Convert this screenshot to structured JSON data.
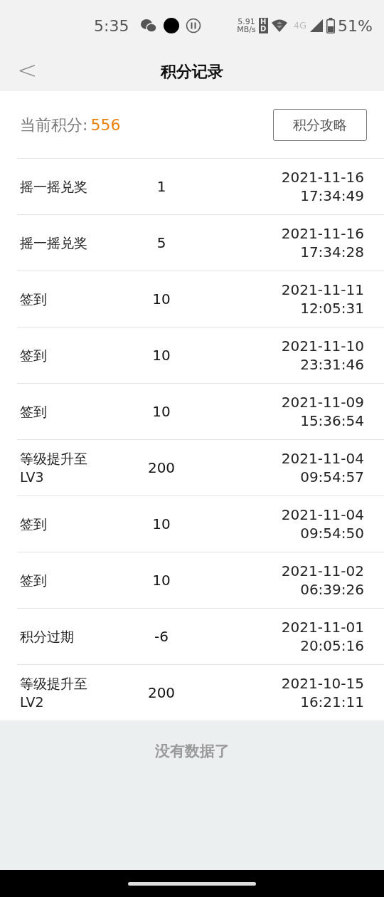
{
  "status_bar": {
    "time": "5:35",
    "net_speed": "5.91",
    "net_unit": "MB/s",
    "hd": "HD",
    "network": "4G",
    "battery": "51%"
  },
  "header": {
    "back": "<",
    "title": "积分记录"
  },
  "summary": {
    "label": "当前积分:",
    "points": "556",
    "guide_button": "积分攻略"
  },
  "records": [
    {
      "name": "摇一摇兑奖",
      "points": "1",
      "date": "2021-11-16",
      "time": "17:34:49"
    },
    {
      "name": "摇一摇兑奖",
      "points": "5",
      "date": "2021-11-16",
      "time": "17:34:28"
    },
    {
      "name": "签到",
      "points": "10",
      "date": "2021-11-11",
      "time": "12:05:31"
    },
    {
      "name": "签到",
      "points": "10",
      "date": "2021-11-10",
      "time": "23:31:46"
    },
    {
      "name": "签到",
      "points": "10",
      "date": "2021-11-09",
      "time": "15:36:54"
    },
    {
      "name": "等级提升至LV3",
      "points": "200",
      "date": "2021-11-04",
      "time": "09:54:57"
    },
    {
      "name": "签到",
      "points": "10",
      "date": "2021-11-04",
      "time": "09:54:50"
    },
    {
      "name": "签到",
      "points": "10",
      "date": "2021-11-02",
      "time": "06:39:26"
    },
    {
      "name": "积分过期",
      "points": "-6",
      "date": "2021-11-01",
      "time": "20:05:16"
    },
    {
      "name": "等级提升至LV2",
      "points": "200",
      "date": "2021-10-15",
      "time": "16:21:11"
    }
  ],
  "footer": {
    "message": "没有数据了"
  }
}
